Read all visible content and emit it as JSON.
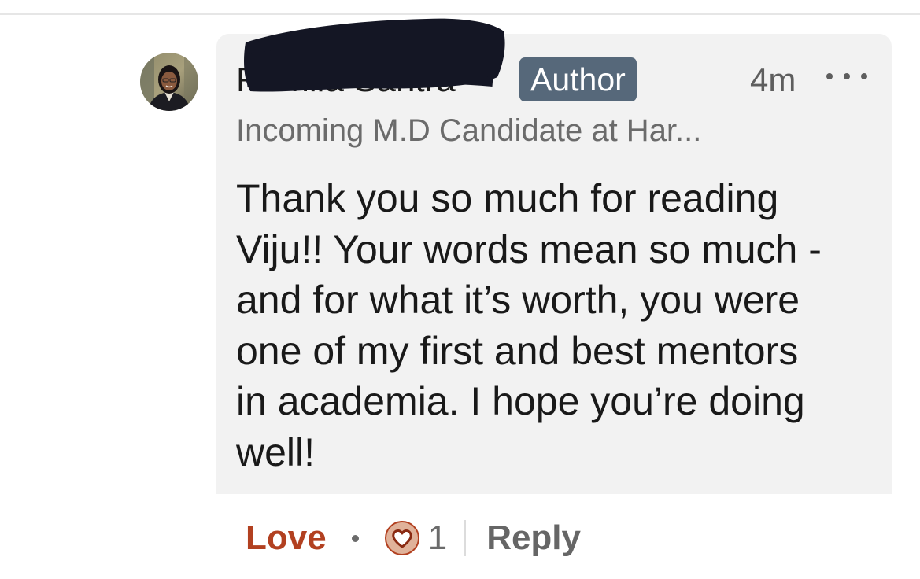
{
  "comment": {
    "author_name": "Romila Santra",
    "author_badge": "Author",
    "timestamp": "4m",
    "headline": "Incoming M.D Candidate at Har...",
    "body_lines": [
      "Thank you so much for reading",
      "Viju!! Your words mean so much -",
      "and for what it’s worth, you were",
      "one of my first and best mentors",
      "in academia. I hope you’re doing",
      "well!"
    ]
  },
  "actions": {
    "love_label": "Love",
    "reaction_count": "1",
    "reply_label": "Reply"
  },
  "icons": {
    "more": "more-options-icon",
    "reaction": "love-reaction-icon"
  },
  "colors": {
    "bubble_bg": "#f2f2f2",
    "badge_bg": "#56687a",
    "love_accent": "#b24020",
    "redaction": "#141624"
  }
}
